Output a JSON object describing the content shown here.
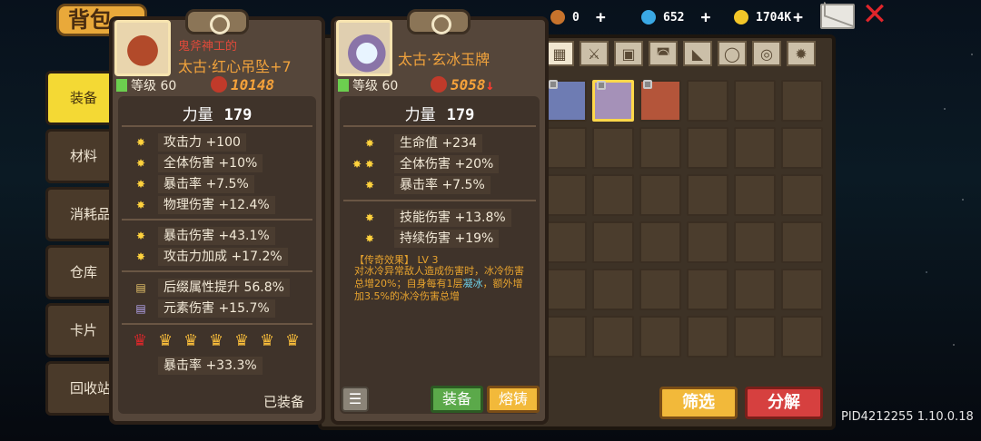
{
  "topbar": {
    "resource1": "0",
    "resource2": "652",
    "resource3": "1704K",
    "plus": "+"
  },
  "bag": {
    "title": "背包",
    "side_tabs": [
      "装备",
      "材料",
      "消耗品",
      "仓库",
      "卡片",
      "回收站"
    ]
  },
  "inventory": {
    "filter_label": "筛选",
    "decompose_label": "分解",
    "pid": "PID4212255 1.10.0.18"
  },
  "card_left": {
    "prefix": "鬼斧神工的",
    "name": "太古·红心吊坠+7",
    "level": "等级 60",
    "power": "10148",
    "strength_label": "力量",
    "strength_value": "179",
    "stats": [
      {
        "bullet": "✸",
        "text": "攻击力 +100"
      },
      {
        "bullet": "✸",
        "text": "全体伤害 +10%"
      },
      {
        "bullet": "✸",
        "text": "暴击率 +7.5%"
      },
      {
        "bullet": "✸",
        "text": "物理伤害 +12.4%"
      },
      {
        "bullet": "✸",
        "text": "暴击伤害 +43.1%"
      },
      {
        "bullet": "✸",
        "text": "攻击力加成 +17.2%"
      },
      {
        "bullet": "▤",
        "text": "后缀属性提升 56.8%"
      },
      {
        "bullet": "▤",
        "text": "元素伤害 +15.7%"
      },
      {
        "bullet": "",
        "text": "暴击率 +33.3%"
      }
    ],
    "equipped_label": "已装备"
  },
  "card_right": {
    "name": "太古·玄冰玉牌",
    "level": "等级 60",
    "power": "5058",
    "power_trend": "↓",
    "strength_label": "力量",
    "strength_value": "179",
    "stats": [
      {
        "bullet": "✸",
        "text": "生命值 +234"
      },
      {
        "bullet": "✸ ✸",
        "text": "全体伤害 +20%"
      },
      {
        "bullet": "✸",
        "text": "暴击率 +7.5%"
      },
      {
        "bullet": "✸",
        "text": "技能伤害 +13.8%"
      },
      {
        "bullet": "✸",
        "text": "持续伤害 +19%"
      }
    ],
    "legend_title": "【传奇效果】 LV 3",
    "legend_desc_1": "对冰冷异常敌人造成伤害时，冰冷伤害总增20%；自身每有1层",
    "legend_desc_hl": "凝冰",
    "legend_desc_2": "，额外增加3.5%的冰冷伤害总增",
    "list_label": "☰",
    "equip_label": "装备",
    "forge_label": "熔铸"
  },
  "colors": {
    "accent_gold": "#f2b93a",
    "danger_red": "#d6403f",
    "equip_green": "#5ba94a",
    "legend_orange": "#e7a32e"
  }
}
